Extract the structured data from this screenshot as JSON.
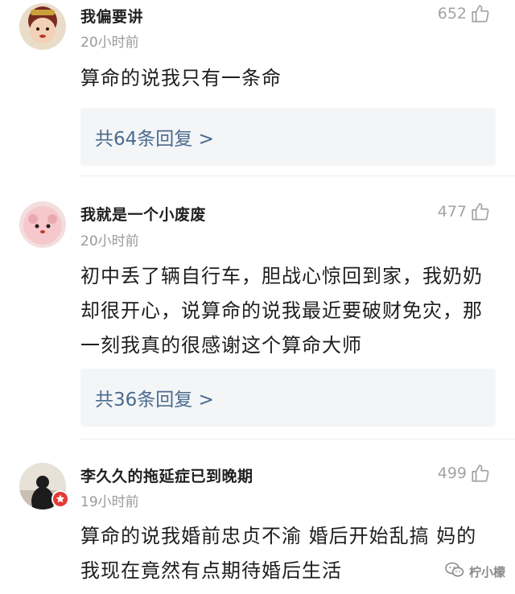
{
  "comments": [
    {
      "username": "我偏要讲",
      "time": "20小时前",
      "likes": "652",
      "text": "算命的说我只有一条命",
      "replies": "共64条回复 >"
    },
    {
      "username": "我就是一个小废废",
      "time": "20小时前",
      "likes": "477",
      "text": "初中丢了辆自行车，胆战心惊回到家，我奶奶却很开心，说算命的说我最近要破财免灾，那一刻我真的很感谢这个算命大师",
      "replies": "共36条回复 >"
    },
    {
      "username": "李久久的拖延症已到晚期",
      "time": "19小时前",
      "likes": "499",
      "text": "算命的说我婚前忠贞不渝 婚后开始乱搞 妈的我现在竟然有点期待婚后生活"
    }
  ],
  "icons": {
    "like": "thumbs-up-icon",
    "watermark": "wechat-icon"
  },
  "watermark": "柠小檬",
  "colors": {
    "reply_link": "#4a6b8e",
    "reply_bg": "#f4f5f7",
    "muted": "#9a9a9a",
    "verified_badge": "#e53935"
  }
}
